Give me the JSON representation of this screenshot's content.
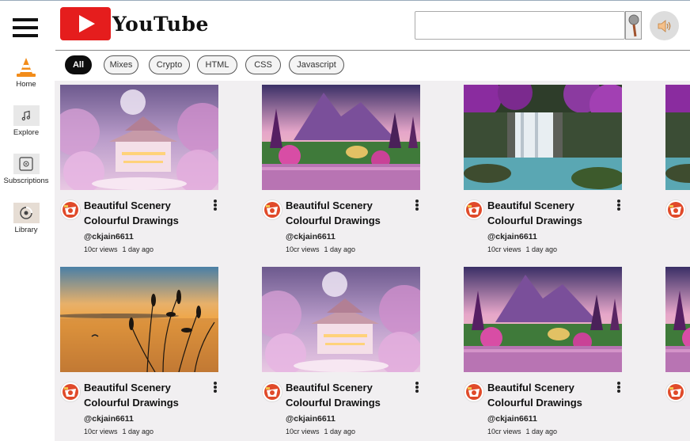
{
  "header": {
    "logo_text": "YouTube",
    "search_placeholder": "",
    "search_value": ""
  },
  "sidebar": {
    "items": [
      {
        "label": "Home",
        "icon": "vlc-cone-icon"
      },
      {
        "label": "Explore",
        "icon": "music-note-icon"
      },
      {
        "label": "Subscriptions",
        "icon": "subscriptions-icon"
      },
      {
        "label": "Library",
        "icon": "library-icon"
      }
    ]
  },
  "chips": [
    "All",
    "Mixes",
    "Crypto",
    "HTML",
    "CSS",
    "Javascript"
  ],
  "active_chip": "All",
  "videos": [
    {
      "title": "Beautiful Scenery Colourful Drawings",
      "channel": "@ckjain6611",
      "views": "10cr views",
      "age": "1 day ago",
      "thumb": "palace"
    },
    {
      "title": "Beautiful Scenery Colourful Drawings",
      "channel": "@ckjain6611",
      "views": "10cr views",
      "age": "1 day ago",
      "thumb": "mountain-lake"
    },
    {
      "title": "Beautiful Scenery Colourful Drawings",
      "channel": "@ckjain6611",
      "views": "10cr views",
      "age": "1 day ago",
      "thumb": "waterfall"
    },
    {
      "title": "Beautiful Scenery Colourful Drawings",
      "channel": "@ckjain6611",
      "views": "10cr views",
      "age": "1 day ago",
      "thumb": "sunset-lake"
    },
    {
      "title": "Beautiful Scenery Colourful Drawings",
      "channel": "@ckjain6611",
      "views": "10cr views",
      "age": "1 day ago",
      "thumb": "palace"
    },
    {
      "title": "Beautiful Scenery Colourful Drawings",
      "channel": "@ckjain6611",
      "views": "10cr views",
      "age": "1 day ago",
      "thumb": "mountain-lake"
    }
  ],
  "colors": {
    "brand_red": "#e51d1d",
    "main_bg": "#f1eff1",
    "chip_active_bg": "#0c0c0c"
  }
}
